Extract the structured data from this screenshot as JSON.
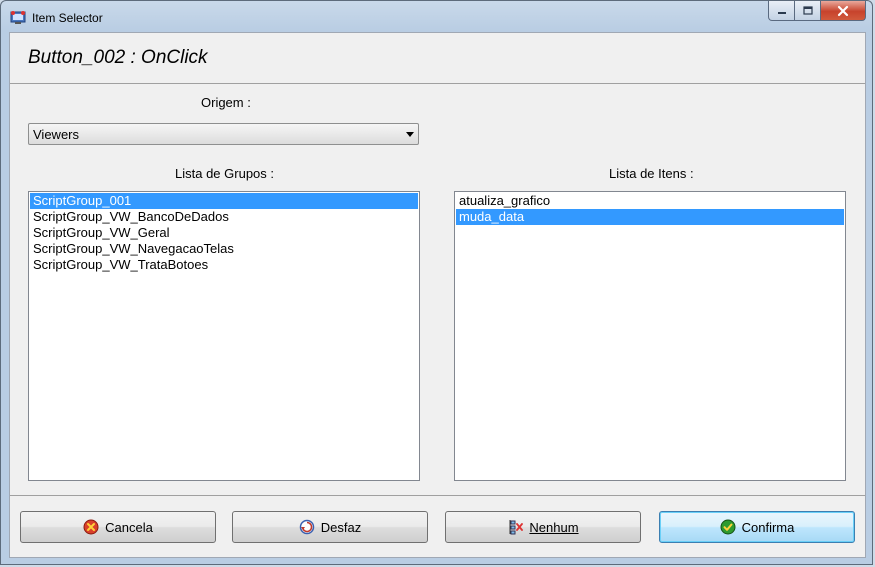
{
  "window": {
    "title": "Item Selector",
    "icons": {
      "app": "app-icon",
      "minimize": "minimize-icon",
      "maximize": "maximize-icon",
      "close": "close-icon"
    }
  },
  "header": {
    "title": "Button_002 : OnClick"
  },
  "origem": {
    "label": "Origem :",
    "selected": "Viewers"
  },
  "grupos": {
    "label": "Lista de Grupos :",
    "items": [
      {
        "label": "ScriptGroup_001",
        "selected": true
      },
      {
        "label": "ScriptGroup_VW_BancoDeDados",
        "selected": false
      },
      {
        "label": "ScriptGroup_VW_Geral",
        "selected": false
      },
      {
        "label": "ScriptGroup_VW_NavegacaoTelas",
        "selected": false
      },
      {
        "label": "ScriptGroup_VW_TrataBotoes",
        "selected": false
      }
    ]
  },
  "itens": {
    "label": "Lista de Itens :",
    "items": [
      {
        "label": "atualiza_grafico",
        "selected": false
      },
      {
        "label": "muda_data",
        "selected": true
      }
    ]
  },
  "buttons": {
    "cancela": {
      "label": "Cancela",
      "icon": "cancel-icon"
    },
    "desfaz": {
      "label": "Desfaz",
      "icon": "undo-icon"
    },
    "nenhum": {
      "label": "Nenhum",
      "icon": "none-icon"
    },
    "confirma": {
      "label": "Confirma",
      "icon": "confirm-icon"
    }
  },
  "colors": {
    "selection": "#3399ff",
    "client_bg": "#f0f0f0",
    "frame": "#b9cde3"
  }
}
